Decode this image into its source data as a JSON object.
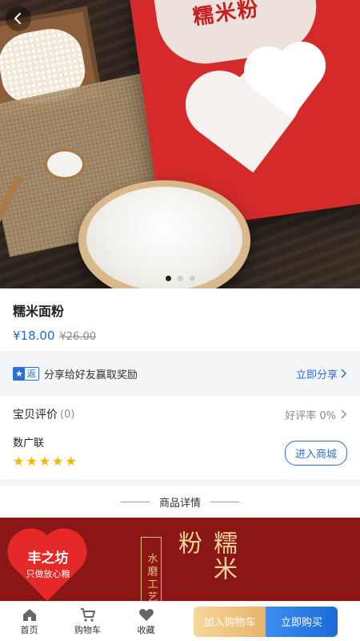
{
  "hero": {
    "bag_text": "糯米粉",
    "carousel_total": 3,
    "carousel_active": 1
  },
  "product": {
    "title": "糯米面粉",
    "price": "¥18.00",
    "old_price": "¥26.00"
  },
  "share": {
    "badge_text": "返",
    "text": "分享给好友赢取奖励",
    "link": "立即分享"
  },
  "review": {
    "label": "宝贝评价",
    "count": "(0)",
    "good_rate": "好评率 0%"
  },
  "shop": {
    "name": "数广联",
    "rating": 5,
    "button": "进入商城"
  },
  "details": {
    "heading": "商品详情",
    "banner_logo": "丰之坊",
    "banner_logo_sub": "只做放心粮",
    "banner_vertical": "水磨工艺",
    "banner_big": "糯米粉"
  },
  "bottom_bar": {
    "tabs": [
      {
        "label": "首页",
        "icon": "home-icon"
      },
      {
        "label": "购物车",
        "icon": "cart-icon"
      },
      {
        "label": "收藏",
        "icon": "heart-icon"
      }
    ],
    "add_to_cart": "加入购物车",
    "buy_now": "立即购买"
  },
  "colors": {
    "accent": "#2d6fd3",
    "price": "#1e6bcc",
    "star": "#f5b400",
    "cart_button": "#e6b46c",
    "buy_button": "#1c6ad8"
  }
}
